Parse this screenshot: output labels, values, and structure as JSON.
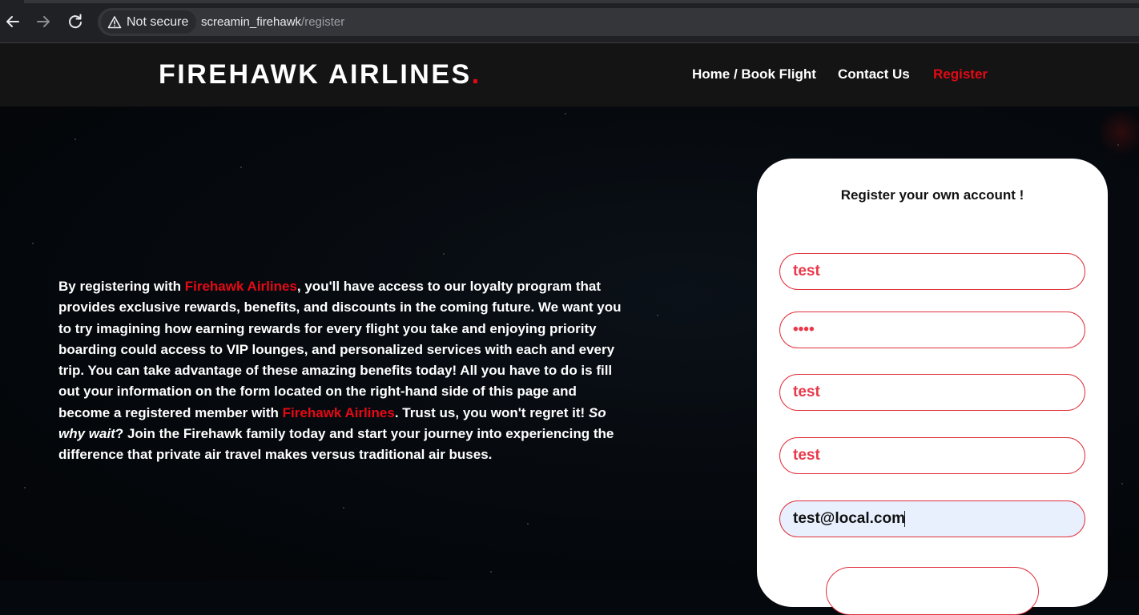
{
  "browser": {
    "security_label": "Not secure",
    "url_host": "screamin_firehawk",
    "url_path": "/register"
  },
  "site": {
    "logo_text": "FIREHAWK AIRLINES",
    "logo_dot": ".",
    "nav": {
      "home": "Home / Book Flight",
      "contact": "Contact Us",
      "register": "Register"
    },
    "accent_color": "#e50914"
  },
  "intro": {
    "p1": "By registering with ",
    "brand1": "Firehawk Airlines",
    "p2": ", you'll have access to our loyalty program that provides exclusive rewards, benefits, and discounts in the coming future. We want you to try imagining how earning rewards for every flight you take and enjoying priority boarding could access to VIP lounges, and personalized services with each and every trip. You can take advantage of these amazing benefits today! All you have to do is fill out your information on the form located on the right-hand side of this page and become a registered member with ",
    "brand2": "Firehawk Airlines",
    "p3": ". Trust us, you won't regret it! ",
    "emph": "So why wait",
    "p4": "? Join the Firehawk family today and start your journey into experiencing the difference that private air travel makes versus traditional air buses."
  },
  "form": {
    "title": "Register your own account !",
    "username": "test",
    "password": "••••",
    "first_name": "test",
    "last_name": "test",
    "email": "test@local.com"
  }
}
